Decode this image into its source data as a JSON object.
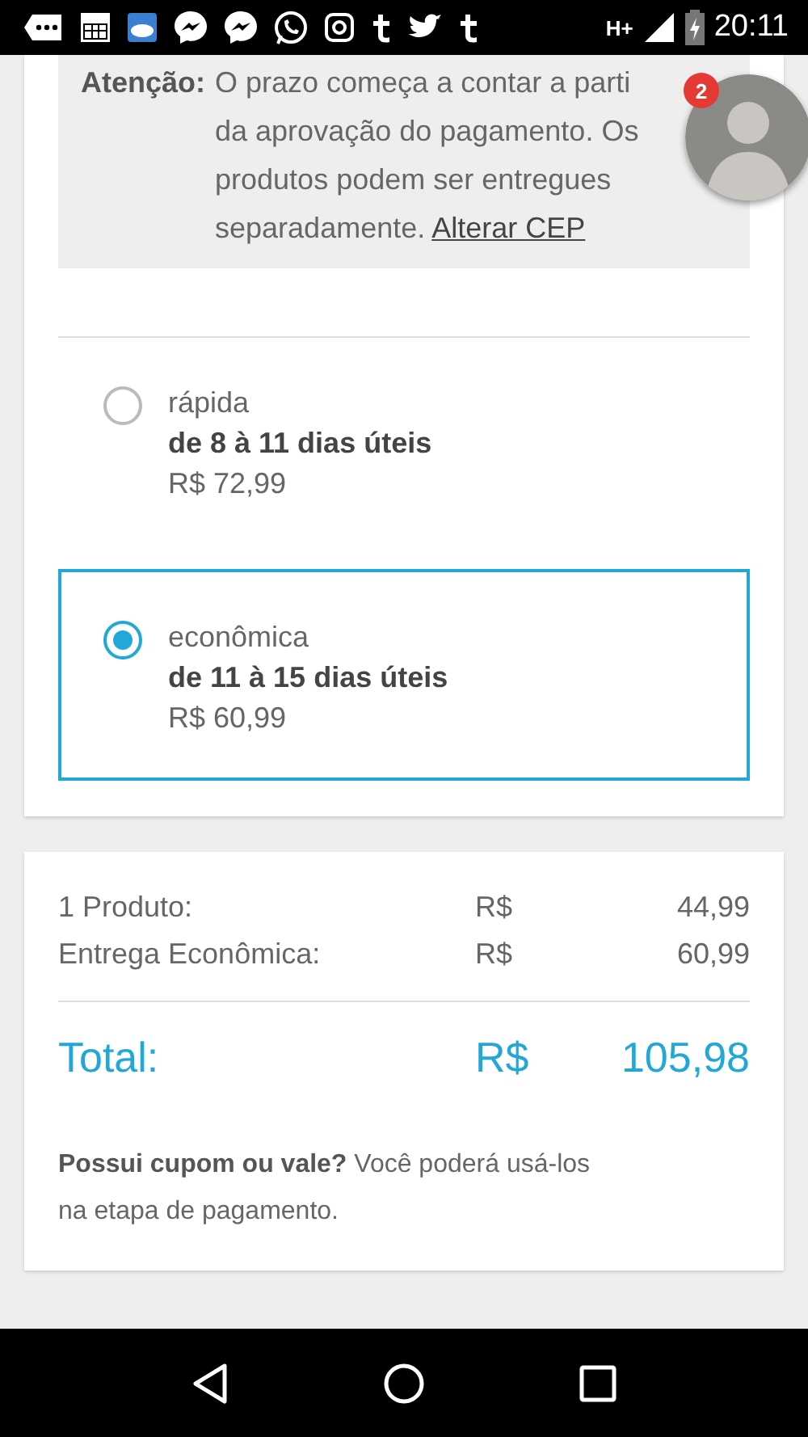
{
  "status_bar": {
    "network": "H+",
    "time": "20:11"
  },
  "notice": {
    "label": "Atenção:",
    "text": "O prazo começa a contar a parti da aprovação do pagamento. Os produtos podem ser entregues separadamente.",
    "link": "Alterar CEP"
  },
  "chat_head": {
    "badge": "2"
  },
  "shipping_options": [
    {
      "name": "rápida",
      "eta": "de 8 à 11 dias úteis",
      "price": "R$ 72,99",
      "selected": false
    },
    {
      "name": "econômica",
      "eta": "de 11 à 15 dias úteis",
      "price": "R$ 60,99",
      "selected": true
    }
  ],
  "summary": {
    "rows": [
      {
        "label": "1 Produto:",
        "currency": "R$",
        "amount": "44,99"
      },
      {
        "label": "Entrega Econômica:",
        "currency": "R$",
        "amount": "60,99"
      }
    ],
    "total": {
      "label": "Total:",
      "currency": "R$",
      "amount": "105,98"
    },
    "coupon_note": "**Possui cupom ou vale?** Você poderá usá-los na etapa de pagamento."
  }
}
